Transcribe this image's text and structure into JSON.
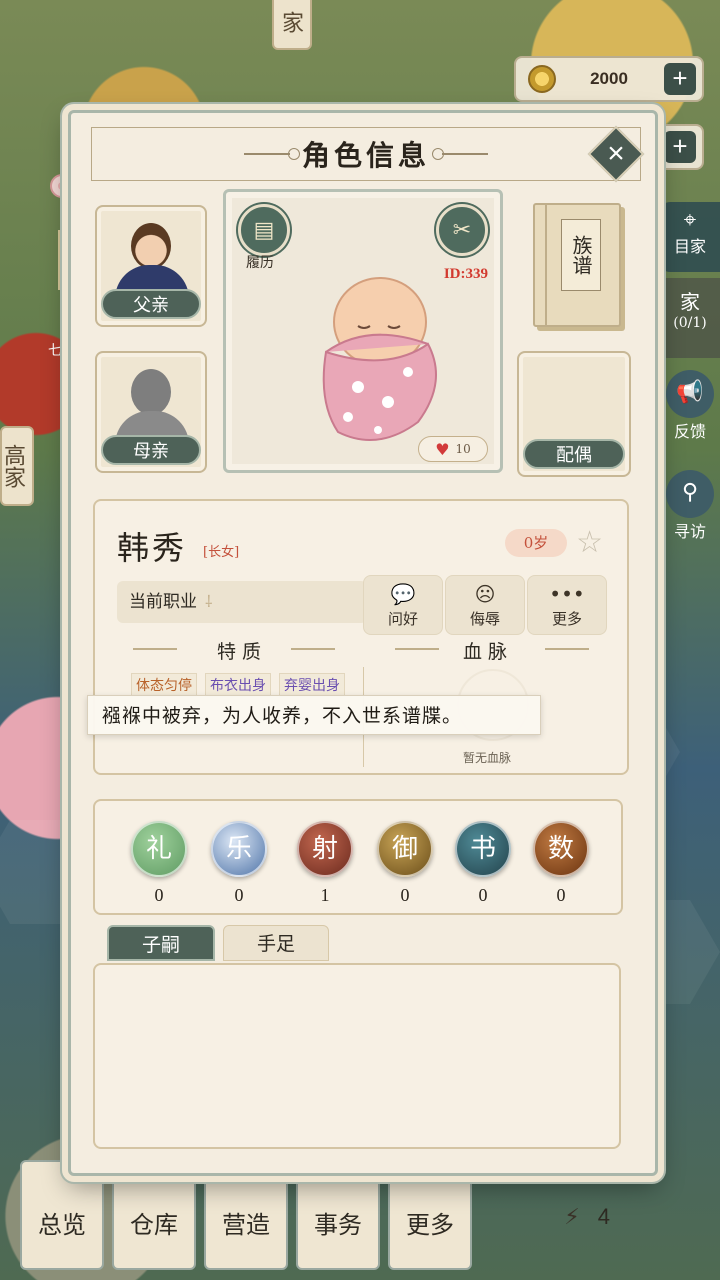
{
  "background": {
    "top_tag": "家",
    "left_tag": "高家",
    "left_small": "七",
    "right_menu": [
      {
        "icon": "map-pin-icon",
        "label": "目家"
      },
      {
        "label": "家"
      },
      {
        "label": "(0/1)"
      },
      {
        "icon": "megaphone-icon",
        "label": "反馈"
      },
      {
        "icon": "magnifier-icon",
        "label": "寻访"
      }
    ]
  },
  "currency": {
    "coins": "2000",
    "coin_icon": "coin-icon",
    "plus": "+"
  },
  "dialog": {
    "title": "角色信息",
    "close": "×"
  },
  "family": {
    "father_label": "父亲",
    "mother_label": "母亲",
    "spouse_label": "配偶",
    "genealogy_label": "族谱"
  },
  "portrait": {
    "resume_label": "履历",
    "id_text": "ID:339",
    "affection": "10"
  },
  "character": {
    "name": "韩秀",
    "role": "[长女]",
    "age": "0岁",
    "job_label": "当前职业",
    "actions": [
      {
        "icon": "speech-bubble-icon",
        "label": "问好"
      },
      {
        "icon": "angry-face-icon",
        "label": "侮辱"
      },
      {
        "icon": "ellipsis-icon",
        "label": "更多"
      }
    ],
    "traits_title": "特质",
    "bloodline_title": "血脉",
    "traits": [
      "体态匀停",
      "布衣出身",
      "弃婴出身"
    ],
    "trait_colors": [
      "#b8622a",
      "#6a4fb0",
      "#6a4fb0"
    ],
    "no_bloodline": "暂无血脉",
    "tooltip": "襁褓中被弃，为人收养，不入世系谱牒。"
  },
  "skills": [
    {
      "name": "礼",
      "value": "0",
      "color": "#5f9b63"
    },
    {
      "name": "乐",
      "value": "0",
      "color": "#4f74a8"
    },
    {
      "name": "射",
      "value": "1",
      "color": "#8a3d2c"
    },
    {
      "name": "御",
      "value": "0",
      "color": "#8a6a2a"
    },
    {
      "name": "书",
      "value": "0",
      "color": "#2f5a66"
    },
    {
      "name": "数",
      "value": "0",
      "color": "#8a4a28"
    }
  ],
  "tabs": {
    "heirs": "子嗣",
    "siblings": "手足"
  },
  "bottom_nav": [
    "总览",
    "仓库",
    "营造",
    "事务",
    "更多"
  ],
  "status": {
    "energy": "4"
  }
}
